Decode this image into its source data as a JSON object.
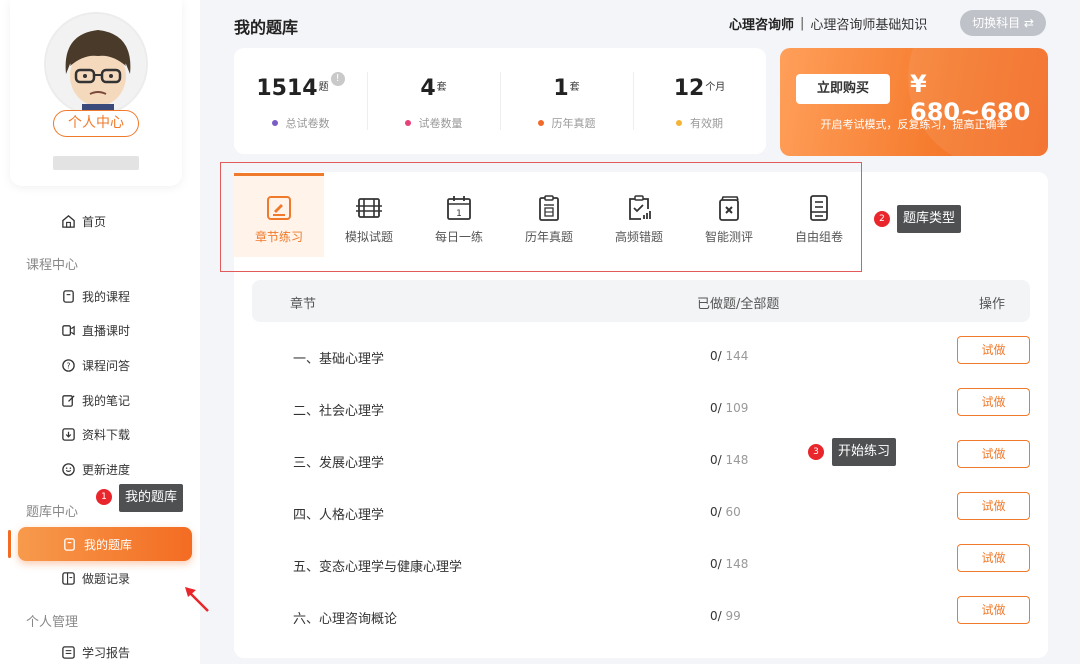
{
  "sidebar": {
    "profile": {
      "center_label": "个人中心"
    },
    "home_label": "首页",
    "sections": {
      "course": "课程中心",
      "bank": "题库中心",
      "personal": "个人管理"
    },
    "course_items": [
      {
        "label": "我的课程",
        "icon": "course-icon"
      },
      {
        "label": "直播课时",
        "icon": "live-icon"
      },
      {
        "label": "课程问答",
        "icon": "question-icon"
      },
      {
        "label": "我的笔记",
        "icon": "note-icon"
      },
      {
        "label": "资料下载",
        "icon": "download-icon"
      },
      {
        "label": "更新进度",
        "icon": "progress-icon"
      }
    ],
    "bank_items": [
      {
        "label": "我的题库",
        "icon": "bank-icon",
        "active": true
      },
      {
        "label": "做题记录",
        "icon": "record-icon"
      }
    ],
    "personal_items": [
      {
        "label": "学习报告",
        "icon": "report-icon"
      }
    ]
  },
  "annotations": [
    {
      "num": "1",
      "text": "我的题库"
    },
    {
      "num": "2",
      "text": "题库类型"
    },
    {
      "num": "3",
      "text": "开始练习"
    }
  ],
  "header": {
    "title": "我的题库",
    "subject_bold": "心理咨询师",
    "separator": "|",
    "subject": "心理咨询师基础知识",
    "switch_label": "切换科目 ⇄"
  },
  "stats": [
    {
      "value": "1514",
      "unit": "题",
      "label": "总试卷数",
      "dot_color": "#7b5cc4",
      "info": "!"
    },
    {
      "value": "4",
      "unit": "套",
      "label": "试卷数量",
      "dot_color": "#e8407a"
    },
    {
      "value": "1",
      "unit": "套",
      "label": "历年真题",
      "dot_color": "#f06a2a"
    },
    {
      "value": "12",
      "unit": "个月",
      "label": "有效期",
      "dot_color": "#f5b335"
    }
  ],
  "purchase": {
    "button": "立即购买",
    "price": "¥ 680~680",
    "tip": "开启考试模式，反复练习，提高正确率"
  },
  "tabs": [
    {
      "label": "章节练习",
      "icon": "chapter-practice-icon",
      "active": true
    },
    {
      "label": "模拟试题",
      "icon": "mock-exam-icon"
    },
    {
      "label": "每日一练",
      "icon": "daily-practice-icon"
    },
    {
      "label": "历年真题",
      "icon": "past-papers-icon"
    },
    {
      "label": "高频错题",
      "icon": "frequent-errors-icon"
    },
    {
      "label": "智能测评",
      "icon": "smart-assessment-icon"
    },
    {
      "label": "自由组卷",
      "icon": "custom-paper-icon"
    }
  ],
  "table": {
    "columns": [
      "章节",
      "已做题/全部题",
      "操作"
    ],
    "rows": [
      {
        "name": "一、基础心理学",
        "done": "0/",
        "total": " 144",
        "action": "试做"
      },
      {
        "name": "二、社会心理学",
        "done": "0/",
        "total": " 109",
        "action": "试做"
      },
      {
        "name": "三、发展心理学",
        "done": "0/",
        "total": " 148",
        "action": "试做"
      },
      {
        "name": "四、人格心理学",
        "done": "0/",
        "total": " 60",
        "action": "试做"
      },
      {
        "name": "五、变态心理学与健康心理学",
        "done": "0/",
        "total": " 148",
        "action": "试做"
      },
      {
        "name": "六、心理咨询概论",
        "done": "0/",
        "total": " 99",
        "action": "试做"
      }
    ]
  },
  "colors": {
    "accent": "#f07a2c",
    "annotation_red": "#e8262b",
    "callout_bg": "#4f5052"
  }
}
